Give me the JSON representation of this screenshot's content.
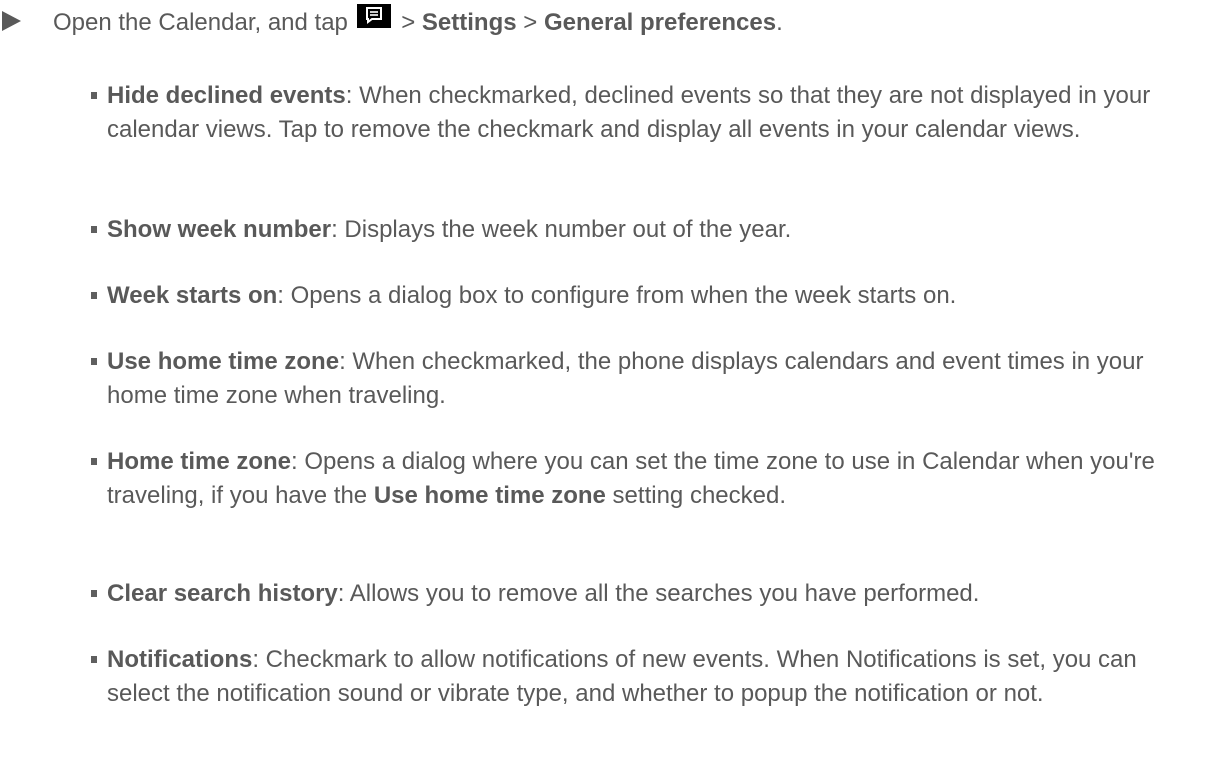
{
  "step": {
    "marker_icon": "right-triangle-bullet-icon",
    "text_before_icon": "Open the Calendar, and tap",
    "menu_icon": "menu-key-icon",
    "sep1": " > ",
    "settings": "Settings",
    "sep2": " > ",
    "general_preferences": "General preferences",
    "end": "."
  },
  "items": [
    {
      "label": "Hide declined events",
      "desc": ": When checkmarked, declined events so that they are not displayed in your calendar views. Tap to remove the checkmark and display all events in your calendar views."
    },
    {
      "label": "Show week number",
      "desc": ": Displays the week number out of the year."
    },
    {
      "label": "Week starts on",
      "desc": ": Opens a dialog box to configure from when the week starts on."
    },
    {
      "label": "Use home time zone",
      "desc": ": When checkmarked, the phone displays calendars and event times in your home time zone when traveling."
    },
    {
      "label": "Home time zone",
      "desc_before": ": Opens a dialog where you can set the time zone to use in Calendar when you're traveling, if you have the ",
      "desc_bold": "Use home time zone",
      "desc_after": " setting checked."
    },
    {
      "label": "Clear search history",
      "desc": ": Allows you to remove all the searches you have performed."
    },
    {
      "label": "Notifications",
      "desc": ": Checkmark to allow notifications of new events. When Notifications is set, you can select the notification sound or vibrate type, and whether to popup the notification or not."
    }
  ],
  "colors": {
    "text": "#595959",
    "bullet": "#5f5f5f",
    "menu_key_bg": "#000000"
  }
}
